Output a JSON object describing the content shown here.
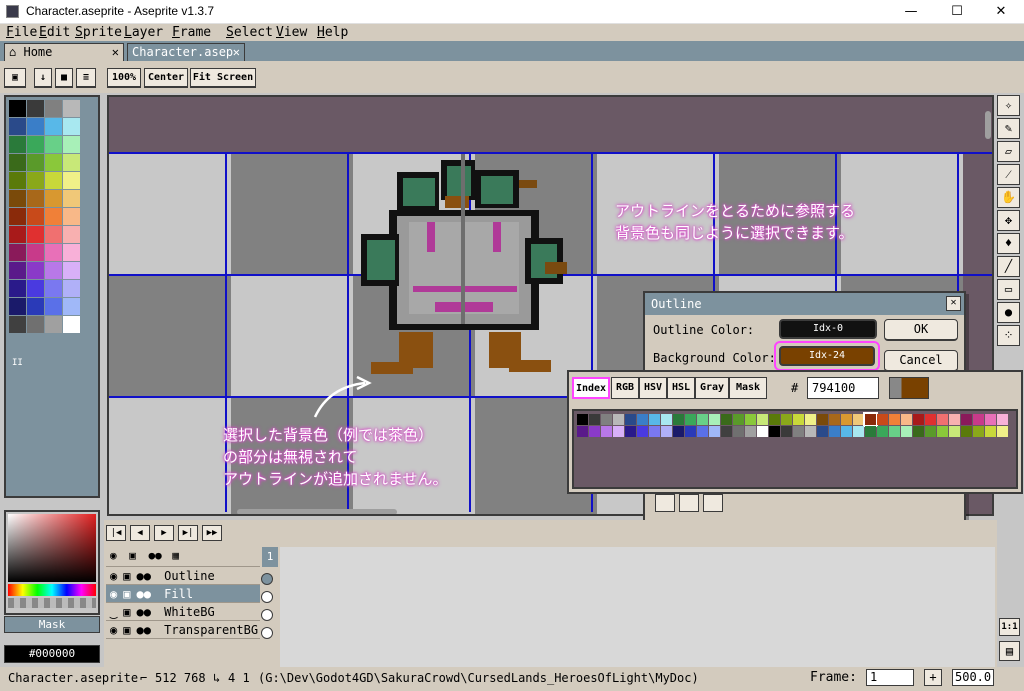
{
  "window": {
    "title": "Character.aseprite - Aseprite v1.3.7",
    "min_label": "—",
    "max_label": "☐",
    "close_label": "✕"
  },
  "menu": [
    {
      "underline": "F",
      "rest": "ile"
    },
    {
      "underline": "E",
      "rest": "dit"
    },
    {
      "underline": "S",
      "rest": "prite"
    },
    {
      "underline": "L",
      "rest": "ayer"
    },
    {
      "underline": "F",
      "rest": "rame"
    },
    {
      "underline": "S",
      "rest": "elect"
    },
    {
      "underline": "V",
      "rest": "iew"
    },
    {
      "underline": "H",
      "rest": "elp"
    }
  ],
  "tabs": {
    "home": "Home",
    "file": "Character.asep",
    "close": "✕"
  },
  "toolbar": {
    "zoom": "100%",
    "center": "Center",
    "fit": "Fit Screen"
  },
  "annotations": {
    "top": "アウトラインをとるために参照する\n背景色も同じように選択できます。",
    "bottom": "選択した背景色（例では茶色）\nの部分は無視されて\nアウトラインが追加されません。"
  },
  "dialog": {
    "title": "Outline",
    "outline_label": "Outline Color:",
    "outline_value": "Idx-0",
    "bg_label": "Background Color:",
    "bg_value": "Idx-24",
    "ok": "OK",
    "cancel": "Cancel"
  },
  "popup": {
    "tabs": [
      "Index",
      "RGB",
      "HSV",
      "HSL",
      "Gray",
      "Mask"
    ],
    "hash": "#",
    "hex": "794100"
  },
  "colorpanel": {
    "mask_label": "Mask",
    "hex": "#000000"
  },
  "layers": [
    {
      "name": "Outline"
    },
    {
      "name": "Fill"
    },
    {
      "name": "WhiteBG"
    },
    {
      "name": "TransparentBG"
    }
  ],
  "frame_header": "1",
  "status": {
    "file": "Character.aseprite",
    "size": "512 768",
    "pos": "4 1",
    "path": "(G:\\Dev\\Godot4GD\\SakuraCrowd\\CursedLands_HeroesOfLight\\MyDoc)",
    "frame_label": "Frame:",
    "frame_value": "1",
    "plus": "+",
    "zoom_value": "500.0"
  },
  "zoom_one": "1:1",
  "colors": {
    "accent": "#f4f",
    "brown": "#794100",
    "grid": "#1010c8",
    "panel": "#d3cbbe",
    "slate": "#7d929e"
  }
}
